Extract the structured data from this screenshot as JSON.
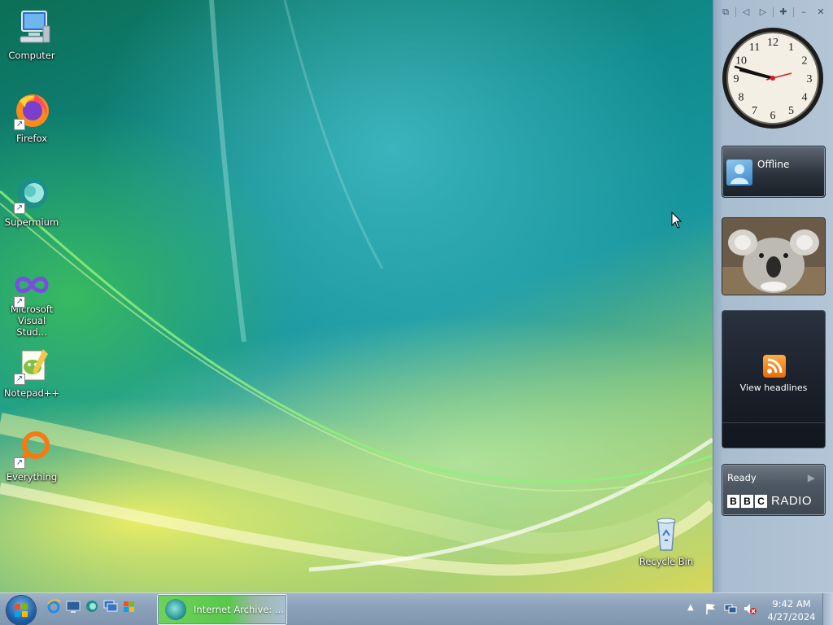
{
  "desktop": {
    "icons": [
      {
        "label": "Computer",
        "icon": "computer-icon"
      },
      {
        "label": "Firefox",
        "icon": "firefox-icon"
      },
      {
        "label": "Supermium",
        "icon": "supermium-icon"
      },
      {
        "label": "Microsoft Visual Stud...",
        "icon": "visual-studio-icon"
      },
      {
        "label": "Notepad++",
        "icon": "notepadpp-icon"
      },
      {
        "label": "Everything",
        "icon": "everything-icon"
      },
      {
        "label": "Recycle Bin",
        "icon": "recycle-bin-icon"
      }
    ]
  },
  "sidebar": {
    "clock": {
      "numerals": [
        "12",
        "1",
        "2",
        "3",
        "4",
        "5",
        "6",
        "7",
        "8",
        "9",
        "10",
        "11"
      ]
    },
    "offline_gadget": {
      "label": "Offline"
    },
    "feeds_gadget": {
      "label": "View headlines"
    },
    "radio_gadget": {
      "status": "Ready",
      "logo_letters": [
        "B",
        "B",
        "C"
      ],
      "logo_word": "RADIO"
    }
  },
  "taskbar": {
    "active_task": {
      "label": "Internet Archive: ..."
    },
    "clock": {
      "time": "9:42 AM",
      "date": "4/27/2024"
    }
  },
  "colors": {
    "taskbar": "#8ba1b9",
    "sidebar": "#b3c5d6",
    "active_task": "#58c94a",
    "feed_orange": "#f08a1c"
  }
}
